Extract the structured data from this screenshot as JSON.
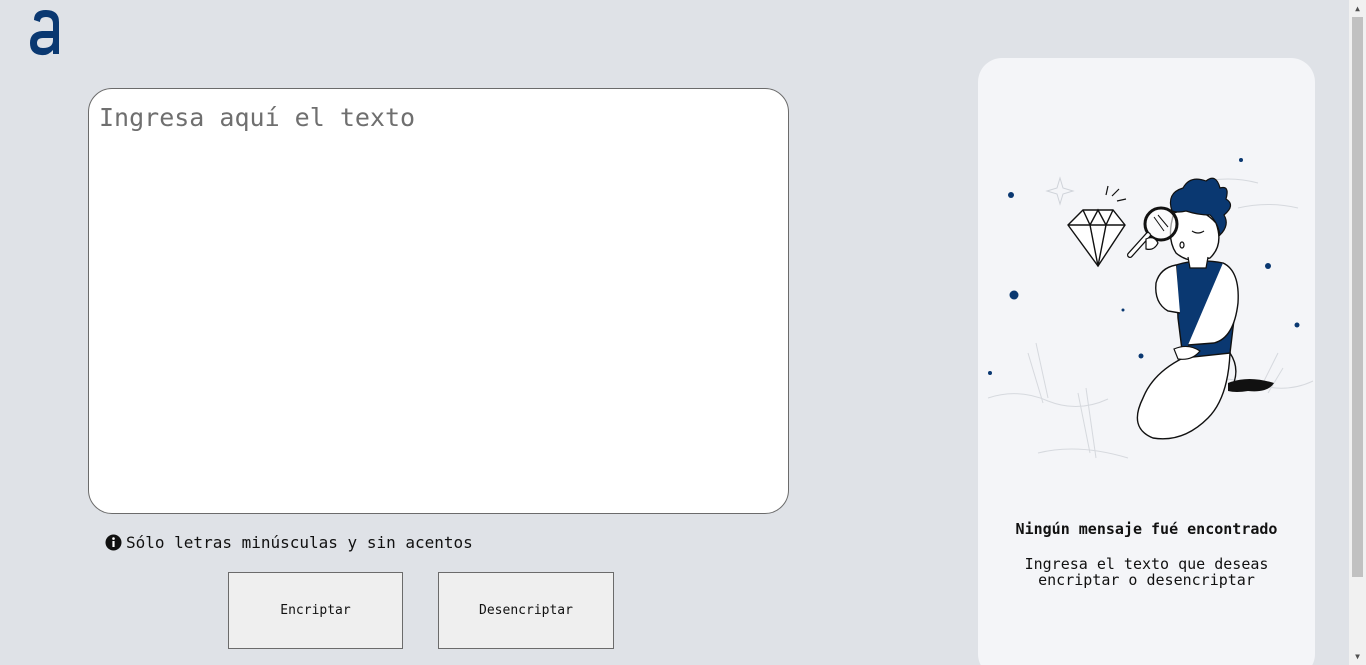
{
  "input": {
    "placeholder": "Ingresa aquí el texto",
    "value": ""
  },
  "hint": {
    "icon": "info-icon",
    "text": "Sólo letras minúsculas y sin acentos"
  },
  "buttons": {
    "encrypt_label": "Encriptar",
    "decrypt_label": "Desencriptar"
  },
  "result": {
    "title": "Ningún mensaje fué encontrado",
    "description": "Ingresa el texto que deseas encriptar o desencriptar"
  },
  "colors": {
    "background": "#dfe2e7",
    "brand": "#0a3871",
    "panel": "#f4f5f8"
  }
}
